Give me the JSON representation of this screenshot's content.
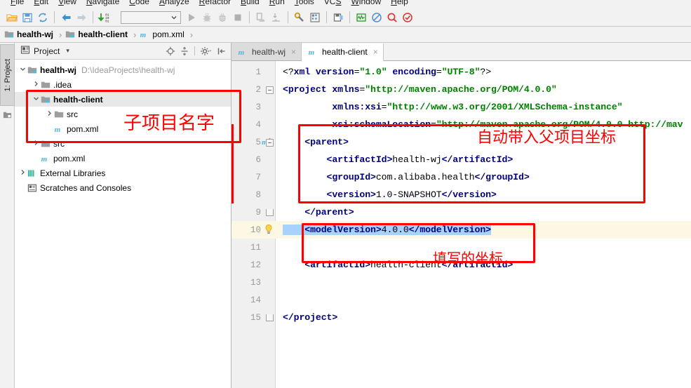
{
  "menubar": {
    "items": [
      {
        "pre": "",
        "key": "F",
        "post": "ile"
      },
      {
        "pre": "",
        "key": "E",
        "post": "dit"
      },
      {
        "pre": "",
        "key": "V",
        "post": "iew"
      },
      {
        "pre": "",
        "key": "N",
        "post": "avigate"
      },
      {
        "pre": "",
        "key": "C",
        "post": "ode"
      },
      {
        "pre": "",
        "key": "A",
        "post": "nalyze"
      },
      {
        "pre": "",
        "key": "R",
        "post": "efactor"
      },
      {
        "pre": "",
        "key": "B",
        "post": "uild"
      },
      {
        "pre": "",
        "key": "R",
        "post": "un"
      },
      {
        "pre": "",
        "key": "T",
        "post": "ools"
      },
      {
        "pre": "VC",
        "key": "S",
        "post": ""
      },
      {
        "pre": "",
        "key": "W",
        "post": "indow"
      },
      {
        "pre": "",
        "key": "H",
        "post": "elp"
      }
    ]
  },
  "toolbar": {
    "buttons": [
      {
        "name": "open-project-icon",
        "title": "Open"
      },
      {
        "name": "save-all-icon",
        "title": "Save All"
      },
      {
        "name": "synchronize-icon",
        "title": "Synchronize"
      },
      {
        "name": "back-arrow-icon",
        "title": "Back"
      },
      {
        "name": "forward-arrow-icon",
        "title": "Forward"
      },
      {
        "name": "compile-icon",
        "title": "Build"
      },
      {
        "name": "run-icon",
        "title": "Run"
      },
      {
        "name": "debug-icon",
        "title": "Debug"
      },
      {
        "name": "coverage-icon",
        "title": "Run with Coverage"
      },
      {
        "name": "stop-icon",
        "title": "Stop"
      },
      {
        "name": "update-project-icon",
        "title": "Update Project"
      },
      {
        "name": "commit-icon",
        "title": "Commit"
      },
      {
        "name": "settings-wrench-icon",
        "title": "Settings"
      },
      {
        "name": "project-structure-icon",
        "title": "Project Structure"
      },
      {
        "name": "sdk-manager-icon",
        "title": "SDK Manager"
      },
      {
        "name": "avd-manager-icon",
        "title": "AVD Manager"
      },
      {
        "name": "no-entry-icon",
        "title": "Disable"
      },
      {
        "name": "search-magnifier-icon",
        "title": "Search Everywhere"
      },
      {
        "name": "check-circle-icon",
        "title": "Inspect"
      }
    ],
    "run_config_value": "",
    "run_config_placeholder": ""
  },
  "breadcrumb": {
    "items": [
      {
        "label": "health-wj",
        "icon": "module-folder-icon",
        "bold": true
      },
      {
        "label": "health-client",
        "icon": "module-folder-icon",
        "bold": true
      },
      {
        "label": "pom.xml",
        "icon": "maven-m-icon",
        "bold": false
      }
    ],
    "separator": "›"
  },
  "left_strip": {
    "project_tab_label": "1: Project",
    "structure_icon": "structure-icon"
  },
  "project_panel": {
    "title": "Project",
    "dropdown_caret": "▾",
    "header_icons": [
      {
        "name": "locate-target-icon"
      },
      {
        "name": "collapse-all-icon"
      },
      {
        "name": "settings-gear-icon"
      },
      {
        "name": "hide-panel-icon"
      }
    ],
    "tree": [
      {
        "indent": 0,
        "twisty": "v",
        "icon": "module-folder-icon",
        "label": "health-wj",
        "bold": true,
        "path": "D:\\IdeaProjects\\health-wj",
        "selected": false
      },
      {
        "indent": 1,
        "twisty": ">",
        "icon": "folder-icon",
        "label": ".idea",
        "bold": false,
        "path": "",
        "selected": false
      },
      {
        "indent": 1,
        "twisty": "v",
        "icon": "module-folder-icon",
        "label": "health-client",
        "bold": true,
        "path": "",
        "selected": true
      },
      {
        "indent": 2,
        "twisty": ">",
        "icon": "folder-icon",
        "label": "src",
        "bold": false,
        "path": "",
        "selected": false
      },
      {
        "indent": 2,
        "twisty": "",
        "icon": "maven-m-icon",
        "label": "pom.xml",
        "bold": false,
        "path": "",
        "selected": false
      },
      {
        "indent": 1,
        "twisty": ">",
        "icon": "folder-icon",
        "label": "src",
        "bold": false,
        "path": "",
        "selected": false
      },
      {
        "indent": 1,
        "twisty": "",
        "icon": "maven-m-icon",
        "label": "pom.xml",
        "bold": false,
        "path": "",
        "selected": false
      },
      {
        "indent": 0,
        "twisty": ">",
        "icon": "external-libraries-icon",
        "label": "External Libraries",
        "bold": false,
        "path": "",
        "selected": false
      },
      {
        "indent": 0,
        "twisty": "",
        "icon": "scratches-icon",
        "label": "Scratches and Consoles",
        "bold": false,
        "path": "",
        "selected": false
      }
    ]
  },
  "editor": {
    "tabs": [
      {
        "label": "health-wj",
        "icon": "maven-m-icon",
        "active": false,
        "close": "×"
      },
      {
        "label": "health-client",
        "icon": "maven-m-icon",
        "active": true,
        "close": "×"
      }
    ],
    "lines": [
      {
        "n": "1",
        "indent": 0,
        "highlight": false,
        "fold": "",
        "gmark": "",
        "tokens": [
          {
            "t": "pi",
            "s": "<?"
          },
          {
            "t": "tag",
            "s": "xml"
          },
          {
            "t": "pi",
            "s": " "
          },
          {
            "t": "attr",
            "s": "version"
          },
          {
            "t": "pi",
            "s": "="
          },
          {
            "t": "val",
            "s": "\"1.0\""
          },
          {
            "t": "pi",
            "s": " "
          },
          {
            "t": "attr",
            "s": "encoding"
          },
          {
            "t": "pi",
            "s": "="
          },
          {
            "t": "val",
            "s": "\"UTF-8\""
          },
          {
            "t": "pi",
            "s": "?>"
          }
        ]
      },
      {
        "n": "2",
        "indent": 0,
        "highlight": false,
        "fold": "open",
        "gmark": "",
        "tokens": [
          {
            "t": "tag",
            "s": "<project "
          },
          {
            "t": "attr",
            "s": "xmlns"
          },
          {
            "t": "txt",
            "s": "="
          },
          {
            "t": "val",
            "s": "\"http://maven.apache.org/POM/4.0.0\""
          }
        ]
      },
      {
        "n": "3",
        "indent": 0,
        "highlight": false,
        "fold": "",
        "gmark": "",
        "tokens": [
          {
            "t": "attr",
            "s": "         xmlns:xsi"
          },
          {
            "t": "txt",
            "s": "="
          },
          {
            "t": "val",
            "s": "\"http://www.w3.org/2001/XMLSchema-instance\""
          }
        ]
      },
      {
        "n": "4",
        "indent": 0,
        "highlight": false,
        "fold": "",
        "gmark": "",
        "tokens": [
          {
            "t": "attr",
            "s": "         xsi:schemaLocation"
          },
          {
            "t": "txt",
            "s": "="
          },
          {
            "t": "val",
            "s": "\"http://maven.apache.org/POM/4.0.0 http://mav"
          }
        ]
      },
      {
        "n": "5",
        "indent": 0,
        "highlight": false,
        "fold": "open",
        "gmark": "maven-arrow",
        "tokens": [
          {
            "t": "tag",
            "s": "    <parent>"
          }
        ]
      },
      {
        "n": "6",
        "indent": 0,
        "highlight": false,
        "fold": "",
        "gmark": "",
        "tokens": [
          {
            "t": "tag",
            "s": "        <artifactId>"
          },
          {
            "t": "txt",
            "s": "health-wj"
          },
          {
            "t": "tag",
            "s": "</artifactId>"
          }
        ]
      },
      {
        "n": "7",
        "indent": 0,
        "highlight": false,
        "fold": "",
        "gmark": "",
        "tokens": [
          {
            "t": "tag",
            "s": "        <groupId>"
          },
          {
            "t": "txt",
            "s": "com.alibaba.health"
          },
          {
            "t": "tag",
            "s": "</groupId>"
          }
        ]
      },
      {
        "n": "8",
        "indent": 0,
        "highlight": false,
        "fold": "",
        "gmark": "",
        "tokens": [
          {
            "t": "tag",
            "s": "        <version>"
          },
          {
            "t": "txt",
            "s": "1.0-SNAPSHOT"
          },
          {
            "t": "tag",
            "s": "</version>"
          }
        ]
      },
      {
        "n": "9",
        "indent": 0,
        "highlight": false,
        "fold": "close",
        "gmark": "",
        "tokens": [
          {
            "t": "tag",
            "s": "    </parent>"
          }
        ]
      },
      {
        "n": "10",
        "indent": 0,
        "highlight": true,
        "fold": "",
        "gmark": "bulb",
        "tokens": [
          {
            "t": "sel-tag",
            "s": "    <modelVersion>"
          },
          {
            "t": "sel-txt",
            "s": "4.0.0"
          },
          {
            "t": "sel-tag",
            "s": "</modelVersion>"
          }
        ]
      },
      {
        "n": "11",
        "indent": 0,
        "highlight": false,
        "fold": "",
        "gmark": "",
        "tokens": []
      },
      {
        "n": "12",
        "indent": 0,
        "highlight": false,
        "fold": "",
        "gmark": "",
        "tokens": [
          {
            "t": "tag",
            "s": "    <artifactId>"
          },
          {
            "t": "txt",
            "s": "health-client"
          },
          {
            "t": "tag",
            "s": "</artifactId>"
          }
        ]
      },
      {
        "n": "13",
        "indent": 0,
        "highlight": false,
        "fold": "",
        "gmark": "",
        "tokens": []
      },
      {
        "n": "14",
        "indent": 0,
        "highlight": false,
        "fold": "",
        "gmark": "",
        "tokens": []
      },
      {
        "n": "15",
        "indent": 0,
        "highlight": false,
        "fold": "close",
        "gmark": "",
        "tokens": [
          {
            "t": "tag",
            "s": "</project>"
          }
        ]
      }
    ]
  },
  "annotations": {
    "color": "#ff0000",
    "subproject_label": "子项目名字",
    "parent_label": "自动带入父项目坐标",
    "fill_label": "填写的坐标"
  }
}
